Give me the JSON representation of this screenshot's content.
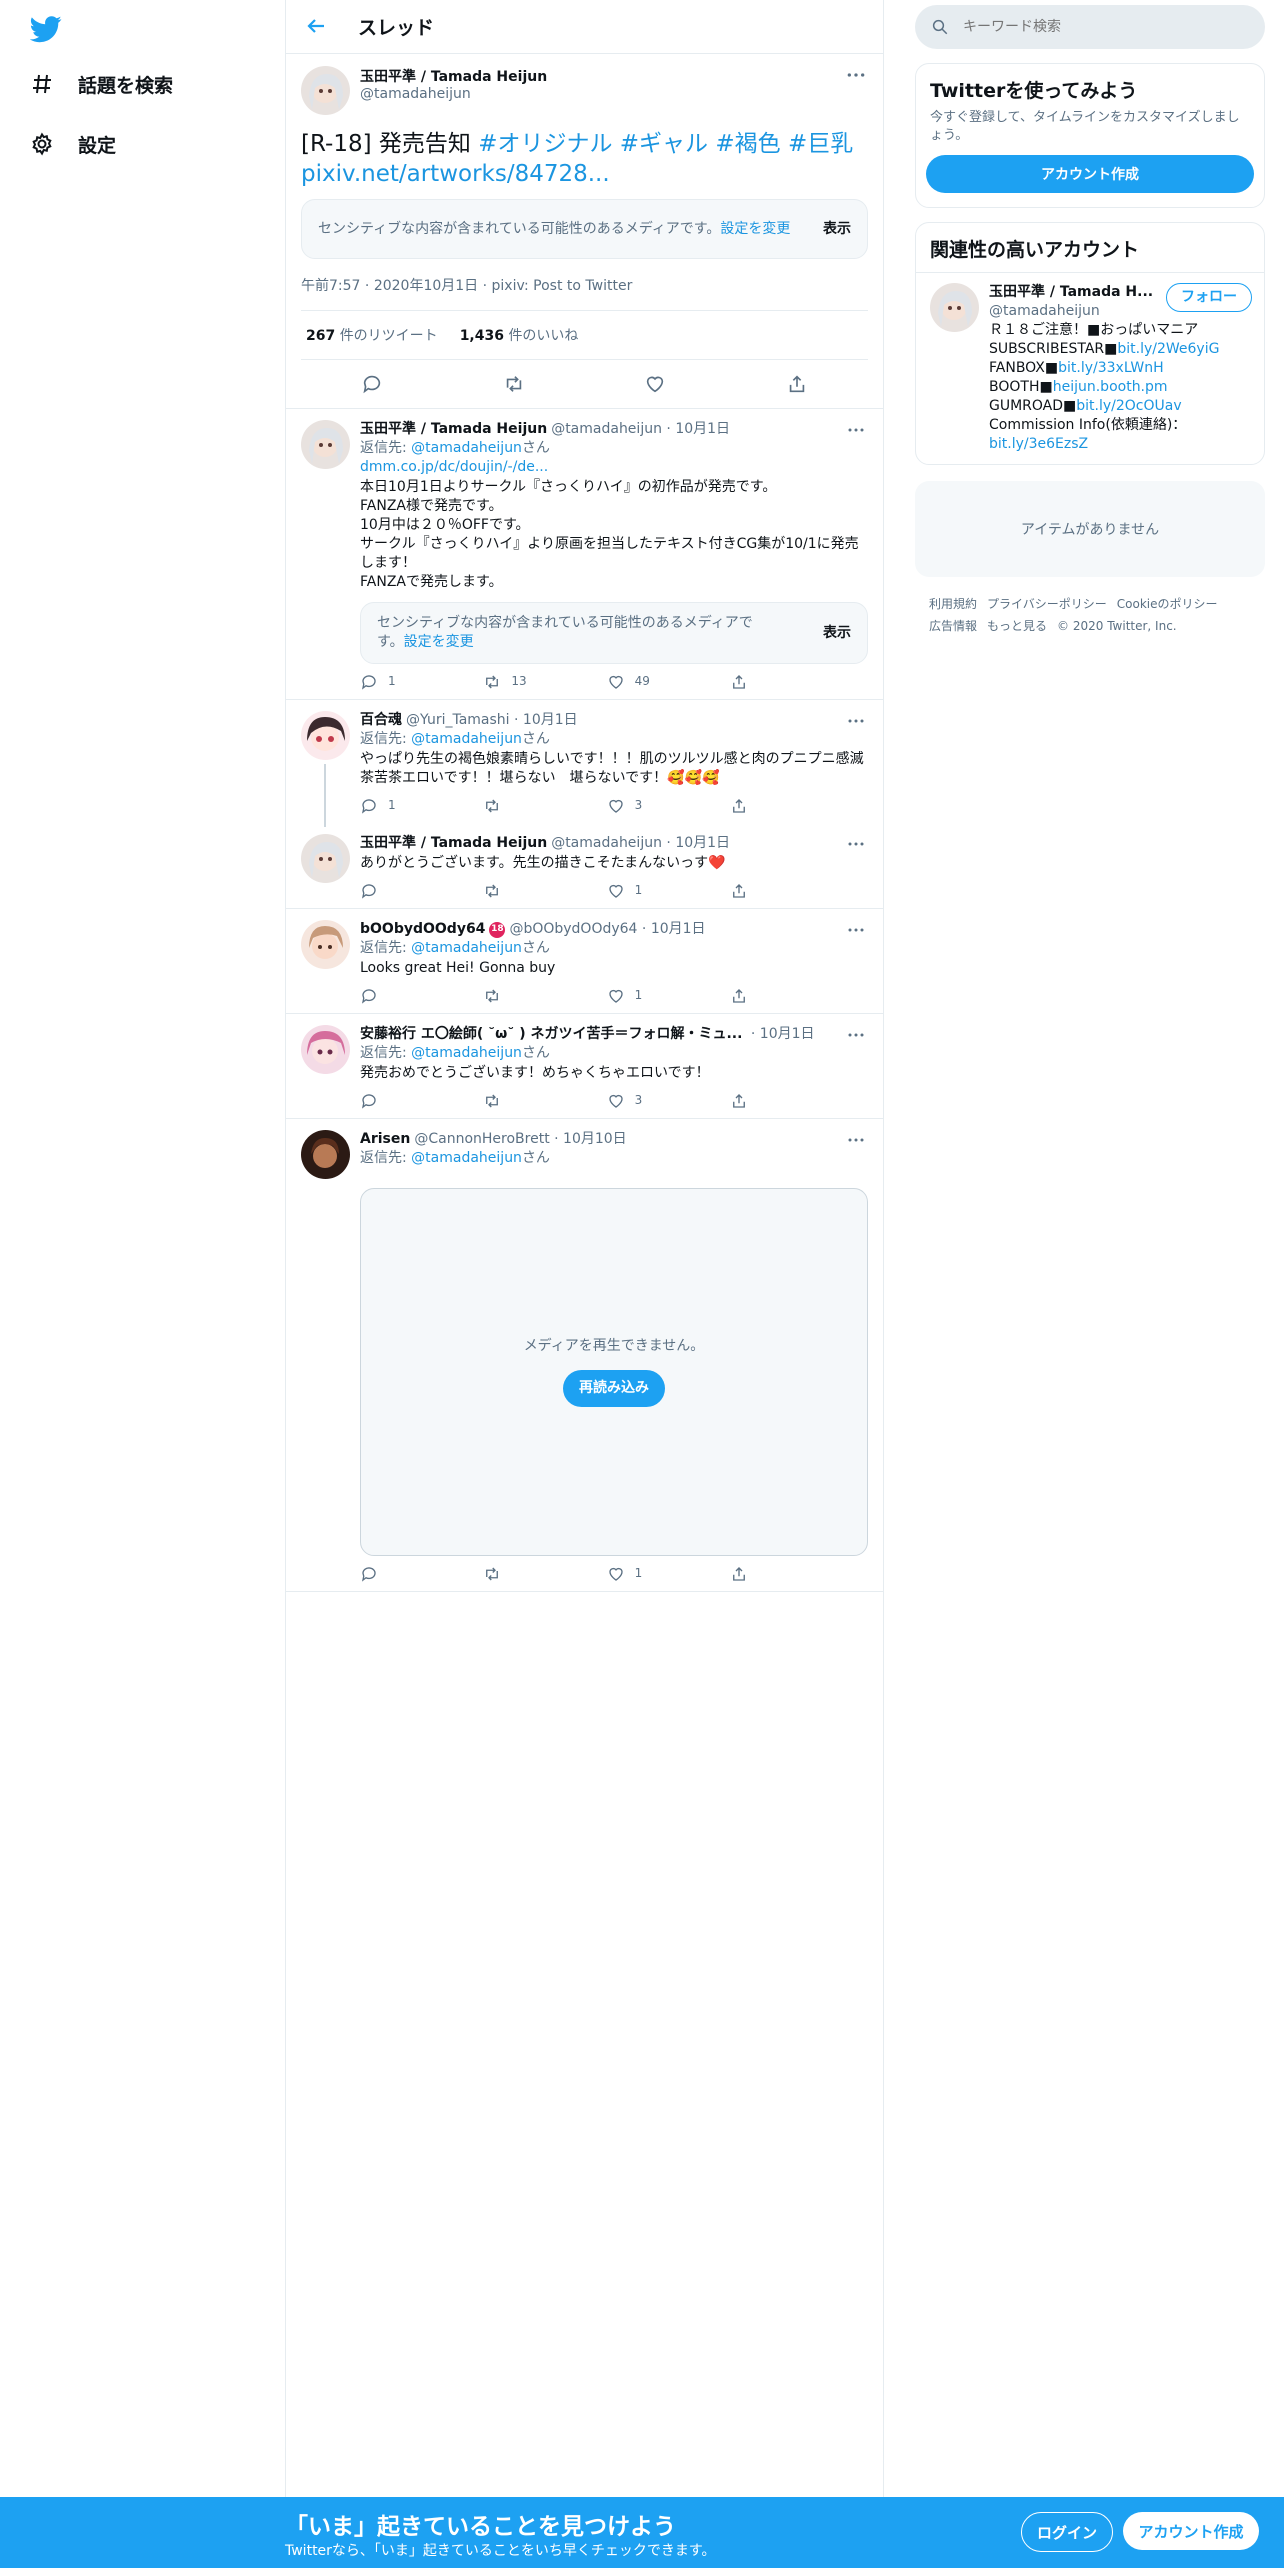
{
  "nav": {
    "explore": "話題を検索",
    "settings": "設定"
  },
  "header": {
    "title": "スレッド"
  },
  "focal": {
    "name": "玉田平準 / Tamada Heijun",
    "handle": "@tamadaheijun",
    "text_prefix": "[R-18] 発売告知 ",
    "hashtags": [
      "#オリジナル",
      "#ギャル",
      "#褐色",
      "#巨乳"
    ],
    "link": "pixiv.net/artworks/84728...",
    "sensitive_text": "センシティブな内容が含まれている可能性のあるメディアです。",
    "sensitive_link": "設定を変更",
    "show": "表示",
    "time": "午前7:57",
    "date": "2020年10月1日",
    "source": "pixiv: Post to Twitter",
    "retweets": "267",
    "retweets_label": "件のリツイート",
    "likes": "1,436",
    "likes_label": "件のいいね"
  },
  "replies": [
    {
      "name": "玉田平準 / Tamada Heijun",
      "handle": "@tamadaheijun",
      "date": "10月1日",
      "reply_label": "返信先: ",
      "reply_to": "@tamadaheijun",
      "reply_suffix": "さん",
      "link": "dmm.co.jp/dc/doujin/-/de...",
      "lines": [
        "本日10月1日よりサークル『さっくりハイ』の初作品が発売です。",
        "FANZA様で発売です。",
        "10月中は２０％OFFです。",
        "サークル『さっくりハイ』より原画を担当したテキスト付きCG集が10/1に発売します！",
        "FANZAで発売します。"
      ],
      "sensitive_text": "センシティブな内容が含まれている可能性のあるメディアです。",
      "sensitive_link": "設定を変更",
      "show": "表示",
      "replies": "1",
      "retweets": "13",
      "likes": "49"
    },
    {
      "name": "百合魂",
      "handle": "@Yuri_Tamashi",
      "date": "10月1日",
      "reply_label": "返信先: ",
      "reply_to": "@tamadaheijun",
      "reply_suffix": "さん",
      "text": "やっぱり先生の褐色娘素晴らしいです！！！肌のツルツル感と肉のプニプニ感滅茶苦茶エロいです！！堪らない　堪らないです！🥰🥰🥰",
      "replies": "1",
      "retweets": "",
      "likes": "3"
    },
    {
      "name": "玉田平準 / Tamada Heijun",
      "handle": "@tamadaheijun",
      "date": "10月1日",
      "text": "ありがとうございます。先生の描きこそたまんないっす❤️",
      "replies": "",
      "retweets": "",
      "likes": "1"
    },
    {
      "name": "bOObydOOdy64",
      "badge": "18",
      "handle": "@bOObydOOdy64",
      "date": "10月1日",
      "reply_label": "返信先: ",
      "reply_to": "@tamadaheijun",
      "reply_suffix": "さん",
      "text": "Looks great Hei! Gonna buy",
      "replies": "",
      "retweets": "",
      "likes": "1"
    },
    {
      "name": "安藤裕行 エ〇絵師( ˘ω˘ ) ネガツイ苦手＝フォロ解・ミュ...",
      "handle": "",
      "date": "10月1日",
      "reply_label": "返信先: ",
      "reply_to": "@tamadaheijun",
      "reply_suffix": "さん",
      "text": "発売おめでとうございます！めちゃくちゃエロいです！",
      "replies": "",
      "retweets": "",
      "likes": "3"
    },
    {
      "name": "Arisen",
      "handle": "@CannonHeroBrett",
      "date": "10月10日",
      "reply_label": "返信先: ",
      "reply_to": "@tamadaheijun",
      "reply_suffix": "さん",
      "media_msg": "メディアを再生できません。",
      "reload": "再読み込み",
      "replies": "",
      "retweets": "",
      "likes": "1"
    }
  ],
  "right": {
    "search_placeholder": "キーワード検索",
    "signup_title": "Twitterを使ってみよう",
    "signup_sub": "今すぐ登録して、タイムラインをカスタマイズしましょう。",
    "signup_btn": "アカウント作成",
    "related_title": "関連性の高いアカウント",
    "related": {
      "name": "玉田平準 / Tamada H...",
      "handle": "@tamadaheijun",
      "follow": "フォロー",
      "bio1": "Ｒ１８ご注意！■おっぱいマニア",
      "bio2_pre": "SUBSCRIBESTAR■",
      "bio2_link": "bit.ly/2We6yiG",
      "bio3_pre": "FANBOX■",
      "bio3_link": "bit.ly/33xLWnH",
      "bio4_pre": "BOOTH■",
      "bio4_link": "heijun.booth.pm",
      "bio5_pre": "GUMROAD■",
      "bio5_link": "bit.ly/2OcOUav",
      "bio6": "Commission Info(依頼連絡)：",
      "bio7_link": "bit.ly/3e6EzsZ"
    },
    "empty": "アイテムがありません",
    "footer": [
      "利用規約",
      "プライバシーポリシー",
      "Cookieのポリシー",
      "広告情報",
      "もっと見る",
      "© 2020 Twitter, Inc."
    ]
  },
  "bottom": {
    "title": "「いま」起きていることを見つけよう",
    "sub": "Twitterなら、「いま」起きていることをいち早くチェックできます。",
    "login": "ログイン",
    "signup": "アカウント作成"
  },
  "colors": {
    "accent": "#1da1f2",
    "link": "#1b95e0",
    "muted": "#5b7083",
    "border": "#e6ecf0"
  }
}
